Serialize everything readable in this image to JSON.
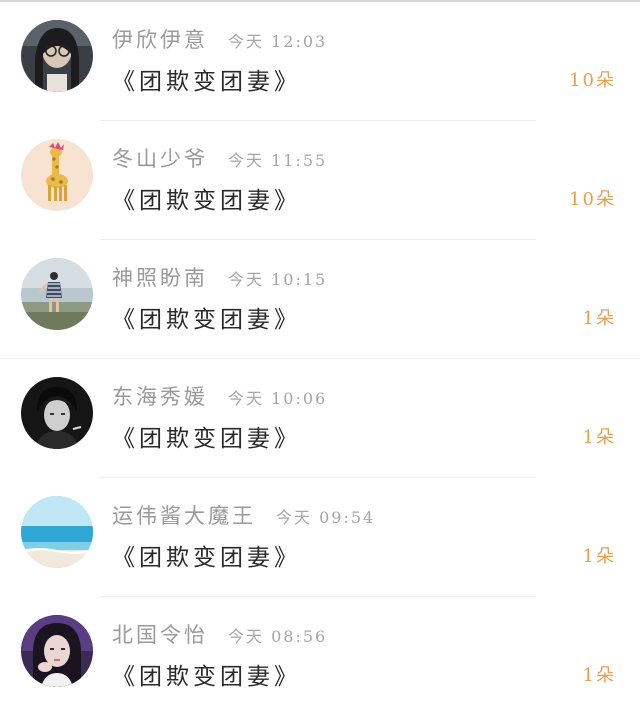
{
  "rows": [
    {
      "name": "伊欣伊意",
      "time": "今天 12:03",
      "gift": "《团欺变团妻》",
      "count": "10朵",
      "avatar": "avatar-girl-glasses"
    },
    {
      "name": "冬山少爷",
      "time": "今天 11:55",
      "gift": "《团欺变团妻》",
      "count": "10朵",
      "avatar": "avatar-giraffe"
    },
    {
      "name": "神照盼南",
      "time": "今天 10:15",
      "gift": "《团欺变团妻》",
      "count": "1朵",
      "avatar": "avatar-beach-person"
    },
    {
      "name": "东海秀媛",
      "time": "今天 10:06",
      "gift": "《团欺变团妻》",
      "count": "1朵",
      "avatar": "avatar-bw-boy"
    },
    {
      "name": "运伟酱大魔王",
      "time": "今天 09:54",
      "gift": "《团欺变团妻》",
      "count": "1朵",
      "avatar": "avatar-sea-horizon"
    },
    {
      "name": "北国令怡",
      "time": "今天 08:56",
      "gift": "《团欺变团妻》",
      "count": "1朵",
      "avatar": "avatar-girl-purple"
    }
  ],
  "colors": {
    "name": "#9a9a9a",
    "time": "#a6a6a6",
    "gift": "#2a2a2a",
    "count": "#e3a24f"
  }
}
